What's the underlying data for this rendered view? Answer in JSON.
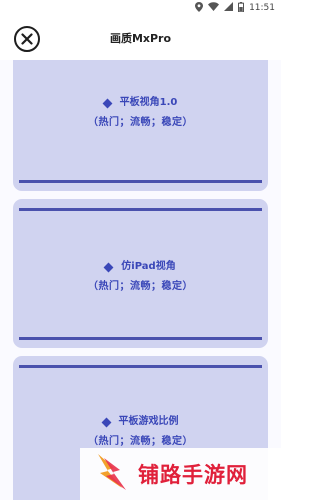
{
  "status_bar": {
    "time": "11:51",
    "icons": [
      "location-icon",
      "wifi-icon",
      "signal-icon",
      "battery-icon"
    ]
  },
  "header": {
    "title": "画质MxPro",
    "close_icon": "close-circle-icon"
  },
  "cards": [
    {
      "title": "平板视角1.0",
      "subtitle": "（热门；流畅；稳定）"
    },
    {
      "title": "仿iPad视角",
      "subtitle": "（热门；流畅；稳定）"
    },
    {
      "title": "平板游戏比例",
      "subtitle": "（热门；流畅；稳定）"
    }
  ],
  "watermark": {
    "text": "铺路手游网",
    "logo_icon": "lightning-logo-icon"
  },
  "colors": {
    "card_bg": "#d0d3f0",
    "card_rule": "#4a51ad",
    "card_text": "#3a47b8",
    "watermark_text": "#e0203a"
  }
}
